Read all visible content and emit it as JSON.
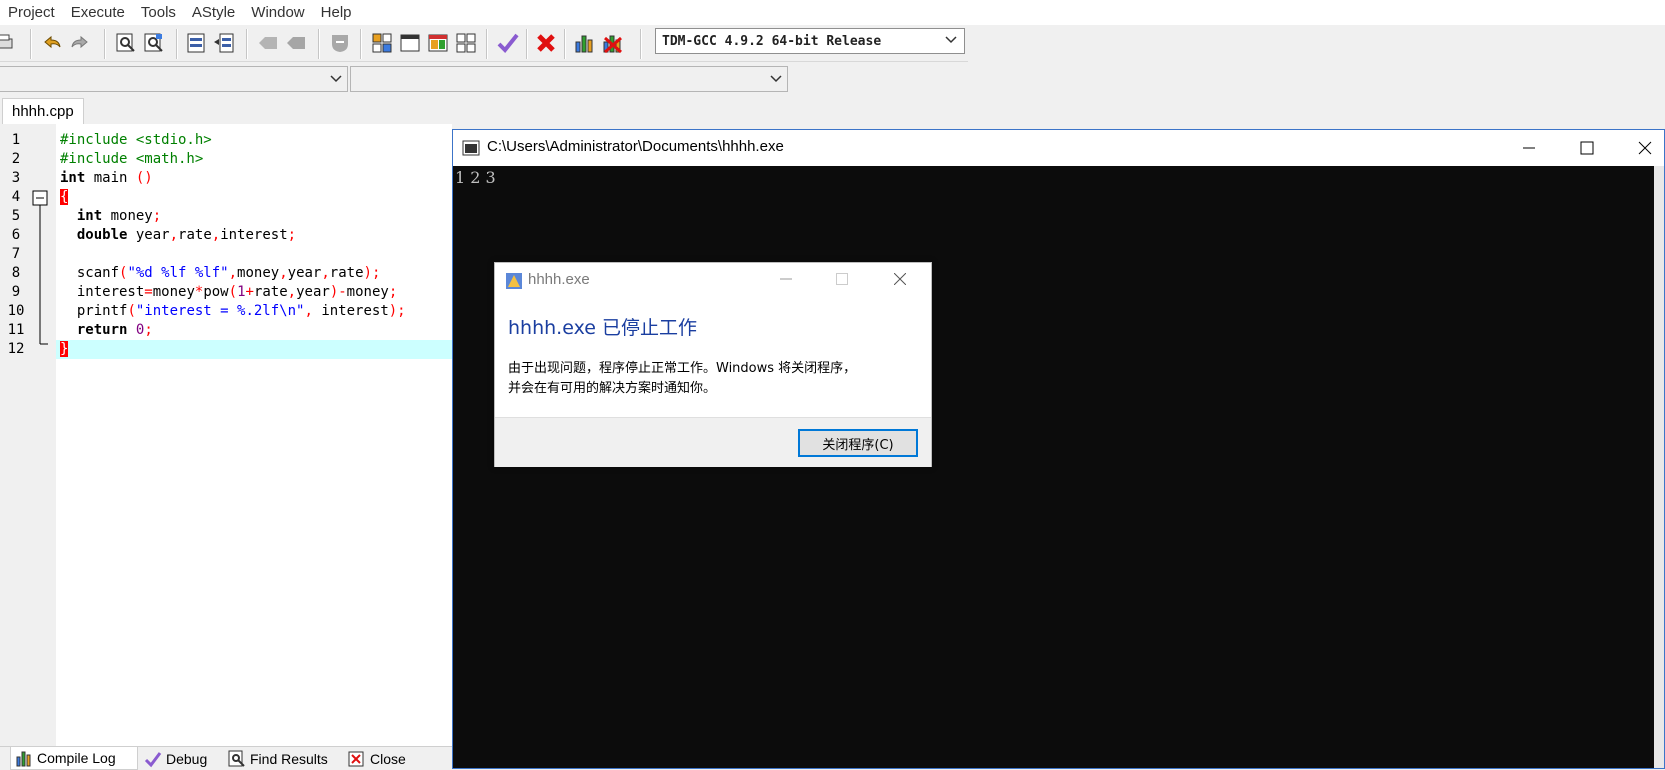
{
  "menubar": {
    "items": [
      "Project",
      "Execute",
      "Tools",
      "AStyle",
      "Window",
      "Help"
    ]
  },
  "toolbar": {
    "compiler": "TDM-GCC 4.9.2 64-bit Release"
  },
  "editor": {
    "tab_label": "hhhh.cpp",
    "line_numbers": [
      "1",
      "2",
      "3",
      "4",
      "5",
      "6",
      "7",
      "8",
      "9",
      "10",
      "11",
      "12"
    ]
  },
  "bottom_tabs": [
    "Compile Log",
    "Debug",
    "Find Results",
    "Close"
  ],
  "console": {
    "title": "C:\\Users\\Administrator\\Documents\\hhhh.exe",
    "output": "1 2 3"
  },
  "dialog": {
    "title": "hhhh.exe",
    "heading": "hhhh.exe 已停止工作",
    "body_line1": "由于出现问题，程序停止正常工作。Windows 将关闭程序，",
    "body_line2": "并会在有可用的解决方案时通知你。",
    "close_button": "关闭程序(C)"
  },
  "colors": {
    "console_bg": "#0c0c0c",
    "current_line": "#ccffff",
    "dialog_heading": "#1a3ea0",
    "button_focus": "#0078d7"
  }
}
